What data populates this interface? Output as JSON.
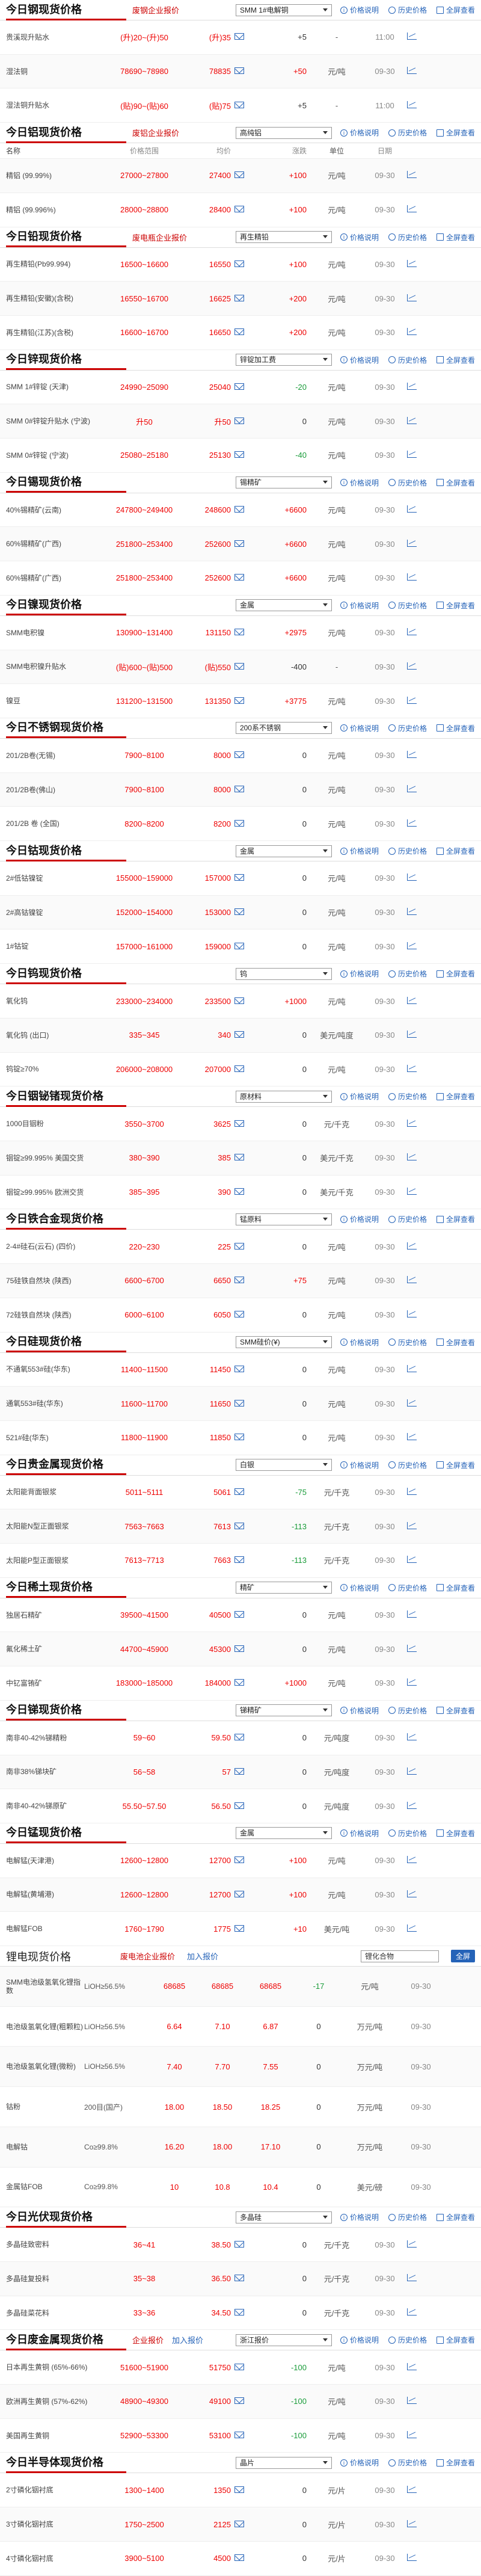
{
  "labels": {
    "price_desc": "价格说明",
    "history": "历史价格",
    "fullscreen": "全屏查看",
    "col_name": "名称",
    "col_range": "价格范围",
    "col_avg": "均价",
    "col_chg": "涨跌",
    "col_unit": "单位",
    "col_date": "日期"
  },
  "sections": [
    {
      "title": "今日钢现货价格",
      "link": "废钢企业报价",
      "select": "SMM 1#电解铜",
      "rows": [
        {
          "name": "贵溪现升贴水",
          "range": "(升)20~(升)50",
          "avg": "(升)35",
          "chg": "+5",
          "chg_class": "black",
          "unit": "-",
          "date": "11:00"
        },
        {
          "name": "湿法铜",
          "range": "78690~78980",
          "avg": "78835",
          "chg": "+50",
          "chg_class": "red",
          "unit": "元/吨",
          "date": "09-30"
        },
        {
          "name": "湿法铜升贴水",
          "range": "(贴)90~(贴)60",
          "avg": "(贴)75",
          "chg": "+5",
          "chg_class": "black",
          "unit": "-",
          "date": "11:00"
        }
      ]
    },
    {
      "title": "今日铝现货价格",
      "link": "废铝企业报价",
      "select": "高纯铝",
      "rows": [
        {
          "name": "精铝 (99.99%)",
          "range": "27000~27800",
          "avg": "27400",
          "chg": "+100",
          "chg_class": "red",
          "unit": "元/吨",
          "date": "09-30"
        },
        {
          "name": "精铝 (99.996%)",
          "range": "28000~28800",
          "avg": "28400",
          "chg": "+100",
          "chg_class": "red",
          "unit": "元/吨",
          "date": "09-30"
        }
      ]
    },
    {
      "title": "今日铅现货价格",
      "link": "废电瓶企业报价",
      "select": "再生精铅",
      "rows": [
        {
          "name": "再生精铅(Pb99.994)",
          "range": "16500~16600",
          "avg": "16550",
          "chg": "+100",
          "chg_class": "red",
          "unit": "元/吨",
          "date": "09-30"
        },
        {
          "name": "再生精铅(安徽)(含税)",
          "range": "16550~16700",
          "avg": "16625",
          "chg": "+200",
          "chg_class": "red",
          "unit": "元/吨",
          "date": "09-30"
        },
        {
          "name": "再生精铅(江苏)(含税)",
          "range": "16600~16700",
          "avg": "16650",
          "chg": "+200",
          "chg_class": "red",
          "unit": "元/吨",
          "date": "09-30"
        }
      ]
    },
    {
      "title": "今日锌现货价格",
      "link": "",
      "select": "锌锭加工费",
      "rows": [
        {
          "name": "SMM 1#锌锭 (天津)",
          "range": "24990~25090",
          "avg": "25040",
          "chg": "-20",
          "chg_class": "green",
          "unit": "元/吨",
          "date": "09-30"
        },
        {
          "name": "SMM 0#锌锭升贴水 (宁波)",
          "range": "升50",
          "avg": "升50",
          "chg": "0",
          "chg_class": "black",
          "unit": "元/吨",
          "date": "09-30"
        },
        {
          "name": "SMM 0#锌锭 (宁波)",
          "range": "25080~25180",
          "avg": "25130",
          "chg": "-40",
          "chg_class": "green",
          "unit": "元/吨",
          "date": "09-30"
        }
      ]
    },
    {
      "title": "今日锡现货价格",
      "link": "",
      "select": "锡精矿",
      "rows": [
        {
          "name": "40%锡精矿(云南)",
          "range": "247800~249400",
          "avg": "248600",
          "chg": "+6600",
          "chg_class": "red",
          "unit": "元/吨",
          "date": "09-30"
        },
        {
          "name": "60%锡精矿(广西)",
          "range": "251800~253400",
          "avg": "252600",
          "chg": "+6600",
          "chg_class": "red",
          "unit": "元/吨",
          "date": "09-30"
        },
        {
          "name": "60%锡精矿(广西)",
          "range": "251800~253400",
          "avg": "252600",
          "chg": "+6600",
          "chg_class": "red",
          "unit": "元/吨",
          "date": "09-30"
        }
      ]
    },
    {
      "title": "今日镍现货价格",
      "link": "",
      "select": "金属",
      "rows": [
        {
          "name": "SMM电积镍",
          "range": "130900~131400",
          "avg": "131150",
          "chg": "+2975",
          "chg_class": "red",
          "unit": "元/吨",
          "date": "09-30"
        },
        {
          "name": "SMM电积镍升贴水",
          "range": "(贴)600~(贴)500",
          "avg": "(贴)550",
          "chg": "-400",
          "chg_class": "black",
          "unit": "-",
          "date": "09-30"
        },
        {
          "name": "镍豆",
          "range": "131200~131500",
          "avg": "131350",
          "chg": "+3775",
          "chg_class": "red",
          "unit": "元/吨",
          "date": "09-30"
        }
      ]
    },
    {
      "title": "今日不锈钢现货价格",
      "link": "",
      "select": "200系不锈钢",
      "rows": [
        {
          "name": "201/2B卷(无锡)",
          "range": "7900~8100",
          "avg": "8000",
          "chg": "0",
          "chg_class": "black",
          "unit": "元/吨",
          "date": "09-30"
        },
        {
          "name": "201/2B卷(佛山)",
          "range": "7900~8100",
          "avg": "8000",
          "chg": "0",
          "chg_class": "black",
          "unit": "元/吨",
          "date": "09-30"
        },
        {
          "name": "201/2B 卷 (全国)",
          "range": "8200~8200",
          "avg": "8200",
          "chg": "0",
          "chg_class": "black",
          "unit": "元/吨",
          "date": "09-30"
        }
      ]
    },
    {
      "title": "今日钴现货价格",
      "link": "",
      "select": "金属",
      "rows": [
        {
          "name": "2#低钴镍锭",
          "range": "155000~159000",
          "avg": "157000",
          "chg": "0",
          "chg_class": "black",
          "unit": "元/吨",
          "date": "09-30"
        },
        {
          "name": "2#高钴镍锭",
          "range": "152000~154000",
          "avg": "153000",
          "chg": "0",
          "chg_class": "black",
          "unit": "元/吨",
          "date": "09-30"
        },
        {
          "name": "1#钴锭",
          "range": "157000~161000",
          "avg": "159000",
          "chg": "0",
          "chg_class": "black",
          "unit": "元/吨",
          "date": "09-30"
        }
      ]
    },
    {
      "title": "今日钨现货价格",
      "link": "",
      "select": "钨",
      "rows": [
        {
          "name": "氧化钨",
          "range": "233000~234000",
          "avg": "233500",
          "chg": "+1000",
          "chg_class": "red",
          "unit": "元/吨",
          "date": "09-30"
        },
        {
          "name": "氧化钨 (出口)",
          "range": "335~345",
          "avg": "340",
          "chg": "0",
          "chg_class": "black",
          "unit": "美元/吨度",
          "date": "09-30"
        },
        {
          "name": "钨锭≥70%",
          "range": "206000~208000",
          "avg": "207000",
          "chg": "0",
          "chg_class": "black",
          "unit": "元/吨",
          "date": "09-30"
        }
      ]
    },
    {
      "title": "今日铟铋锗现货价格",
      "link": "",
      "select": "原材料",
      "rows": [
        {
          "name": "1000目铟粉",
          "range": "3550~3700",
          "avg": "3625",
          "chg": "0",
          "chg_class": "black",
          "unit": "元/千克",
          "date": "09-30"
        },
        {
          "name": "铟锭≥99.995% 美国交货",
          "range": "380~390",
          "avg": "385",
          "chg": "0",
          "chg_class": "black",
          "unit": "美元/千克",
          "date": "09-30"
        },
        {
          "name": "铟锭≥99.995% 欧洲交货",
          "range": "385~395",
          "avg": "390",
          "chg": "0",
          "chg_class": "black",
          "unit": "美元/千克",
          "date": "09-30"
        }
      ]
    },
    {
      "title": "今日铁合金现货价格",
      "link": "",
      "select": "锰原料",
      "rows": [
        {
          "name": "2-4#硅石(云石) (四价)",
          "range": "220~230",
          "avg": "225",
          "chg": "0",
          "chg_class": "black",
          "unit": "元/吨",
          "date": "09-30"
        },
        {
          "name": "75硅铁自然块 (陕西)",
          "range": "6600~6700",
          "avg": "6650",
          "chg": "+75",
          "chg_class": "red",
          "unit": "元/吨",
          "date": "09-30"
        },
        {
          "name": "72硅铁自然块 (陕西)",
          "range": "6000~6100",
          "avg": "6050",
          "chg": "0",
          "chg_class": "black",
          "unit": "元/吨",
          "date": "09-30"
        }
      ]
    },
    {
      "title": "今日硅现货价格",
      "link": "",
      "select": "SMM硅价(¥)",
      "rows": [
        {
          "name": "不通氧553#硅(华东)",
          "range": "11400~11500",
          "avg": "11450",
          "chg": "0",
          "chg_class": "black",
          "unit": "元/吨",
          "date": "09-30"
        },
        {
          "name": "通氧553#硅(华东)",
          "range": "11600~11700",
          "avg": "11650",
          "chg": "0",
          "chg_class": "black",
          "unit": "元/吨",
          "date": "09-30"
        },
        {
          "name": "521#硅(华东)",
          "range": "11800~11900",
          "avg": "11850",
          "chg": "0",
          "chg_class": "black",
          "unit": "元/吨",
          "date": "09-30"
        }
      ]
    },
    {
      "title": "今日贵金属现货价格",
      "link": "",
      "select": "白银",
      "rows": [
        {
          "name": "太阳能背面银浆",
          "range": "5011~5111",
          "avg": "5061",
          "chg": "-75",
          "chg_class": "green",
          "unit": "元/千克",
          "date": "09-30"
        },
        {
          "name": "太阳能N型正面银浆",
          "range": "7563~7663",
          "avg": "7613",
          "chg": "-113",
          "chg_class": "green",
          "unit": "元/千克",
          "date": "09-30"
        },
        {
          "name": "太阳能P型正面银浆",
          "range": "7613~7713",
          "avg": "7663",
          "chg": "-113",
          "chg_class": "green",
          "unit": "元/千克",
          "date": "09-30"
        }
      ]
    },
    {
      "title": "今日稀土现货价格",
      "link": "",
      "select": "精矿",
      "rows": [
        {
          "name": "独居石精矿",
          "range": "39500~41500",
          "avg": "40500",
          "chg": "0",
          "chg_class": "black",
          "unit": "元/吨",
          "date": "09-30"
        },
        {
          "name": "氟化稀土矿",
          "range": "44700~45900",
          "avg": "45300",
          "chg": "0",
          "chg_class": "black",
          "unit": "元/吨",
          "date": "09-30"
        },
        {
          "name": "中钇富铕矿",
          "range": "183000~185000",
          "avg": "184000",
          "chg": "+1000",
          "chg_class": "red",
          "unit": "元/吨",
          "date": "09-30"
        }
      ]
    },
    {
      "title": "今日锑现货价格",
      "link": "",
      "select": "锑精矿",
      "rows": [
        {
          "name": "南非40-42%锑精粉",
          "range": "59~60",
          "avg": "59.50",
          "chg": "0",
          "chg_class": "black",
          "unit": "元/吨度",
          "date": "09-30"
        },
        {
          "name": "南非38%锑块矿",
          "range": "56~58",
          "avg": "57",
          "chg": "0",
          "chg_class": "black",
          "unit": "元/吨度",
          "date": "09-30"
        },
        {
          "name": "南非40-42%锑原矿",
          "range": "55.50~57.50",
          "avg": "56.50",
          "chg": "0",
          "chg_class": "black",
          "unit": "元/吨度",
          "date": "09-30"
        }
      ]
    },
    {
      "title": "今日锰现货价格",
      "link": "",
      "select": "金属",
      "rows": [
        {
          "name": "电解锰(天津港)",
          "range": "12600~12800",
          "avg": "12700",
          "chg": "+100",
          "chg_class": "red",
          "unit": "元/吨",
          "date": "09-30"
        },
        {
          "name": "电解锰(黄埔港)",
          "range": "12600~12800",
          "avg": "12700",
          "chg": "+100",
          "chg_class": "red",
          "unit": "元/吨",
          "date": "09-30"
        },
        {
          "name": "电解锰FOB",
          "range": "1760~1790",
          "avg": "1775",
          "chg": "+10",
          "chg_class": "red",
          "unit": "美元/吨",
          "date": "09-30"
        }
      ]
    }
  ],
  "lithium": {
    "title": "锂电现货价格",
    "link1": "废电池企业报价",
    "link2": "加入报价",
    "select": "锂化合物",
    "fullscreen": "全屏",
    "rows": [
      {
        "name": "SMM电池级氢氧化锂指数",
        "spec": "LiOH≥56.5%",
        "v1": "68685",
        "v2": "68685",
        "avg": "68685",
        "chg": "-17",
        "unit": "元/吨",
        "date": "09-30"
      },
      {
        "name": "电池级氢氧化锂(粗颗粒)",
        "spec": "LiOH≥56.5%",
        "v1": "6.64",
        "v2": "7.10",
        "avg": "6.87",
        "chg": "0",
        "unit": "万元/吨",
        "date": "09-30"
      },
      {
        "name": "电池级氢氧化锂(微粉)",
        "spec": "LiOH≥56.5%",
        "v1": "7.40",
        "v2": "7.70",
        "avg": "7.55",
        "chg": "0",
        "unit": "万元/吨",
        "date": "09-30"
      },
      {
        "name": "钴粉",
        "spec": "200目(国产)",
        "v1": "18.00",
        "v2": "18.50",
        "avg": "18.25",
        "chg": "0",
        "unit": "万元/吨",
        "date": "09-30"
      },
      {
        "name": "电解钴",
        "spec": "Co≥99.8%",
        "v1": "16.20",
        "v2": "18.00",
        "avg": "17.10",
        "chg": "0",
        "unit": "万元/吨",
        "date": "09-30"
      },
      {
        "name": "金属钴FOB",
        "spec": "Co≥99.8%",
        "v1": "10",
        "v2": "10.8",
        "avg": "10.4",
        "chg": "0",
        "unit": "美元/磅",
        "date": "09-30"
      }
    ]
  },
  "pv": {
    "title": "今日光伏现货价格",
    "select": "多晶硅",
    "rows": [
      {
        "name": "多晶硅致密料",
        "range": "36~41",
        "avg": "38.50",
        "chg": "0",
        "chg_class": "black",
        "unit": "元/千克",
        "date": "09-30"
      },
      {
        "name": "多晶硅复投料",
        "range": "35~38",
        "avg": "36.50",
        "chg": "0",
        "chg_class": "black",
        "unit": "元/千克",
        "date": "09-30"
      },
      {
        "name": "多晶硅菜花料",
        "range": "33~36",
        "avg": "34.50",
        "chg": "0",
        "chg_class": "black",
        "unit": "元/千克",
        "date": "09-30"
      }
    ]
  },
  "nonferrous": {
    "title": "今日废金属现货价格",
    "link1": "企业报价",
    "link2": "加入报价",
    "select": "浙江报价",
    "rows": [
      {
        "name": "日本再生黄铜 (65%-66%)",
        "range": "51600~51900",
        "avg": "51750",
        "chg": "-100",
        "chg_class": "green",
        "unit": "元/吨",
        "date": "09-30"
      },
      {
        "name": "欧洲再生黄铜 (57%-62%)",
        "range": "48900~49300",
        "avg": "49100",
        "chg": "-100",
        "chg_class": "green",
        "unit": "元/吨",
        "date": "09-30"
      },
      {
        "name": "美国再生黄铜",
        "range": "52900~53300",
        "avg": "53100",
        "chg": "-100",
        "chg_class": "green",
        "unit": "元/吨",
        "date": "09-30"
      }
    ]
  },
  "semi": {
    "title": "今日半导体现货价格",
    "select": "晶片",
    "rows": [
      {
        "name": "2寸磷化铟衬底",
        "range": "1300~1400",
        "avg": "1350",
        "chg": "0",
        "chg_class": "black",
        "unit": "元/片",
        "date": "09-30"
      },
      {
        "name": "3寸磷化铟衬底",
        "range": "1750~2500",
        "avg": "2125",
        "chg": "0",
        "chg_class": "black",
        "unit": "元/片",
        "date": "09-30"
      },
      {
        "name": "4寸磷化铟衬底",
        "range": "3900~5100",
        "avg": "4500",
        "chg": "0",
        "chg_class": "black",
        "unit": "元/片",
        "date": "09-30"
      }
    ]
  },
  "colors": {
    "accent": "#c00000",
    "link": "#2563b8",
    "up": "#e00000",
    "down": "#1a9c3a"
  }
}
